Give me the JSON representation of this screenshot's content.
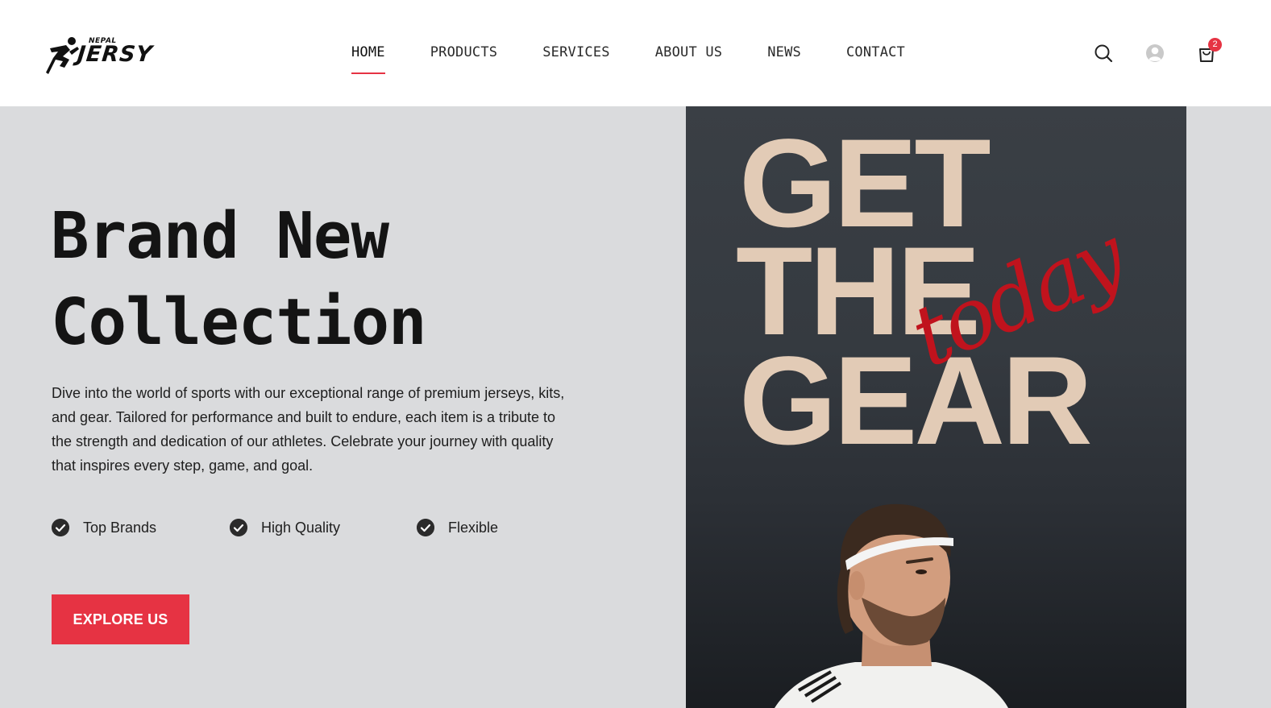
{
  "brand": {
    "small": "NEPAL",
    "main": "JERSY"
  },
  "nav": {
    "items": [
      {
        "label": "HOME",
        "active": true
      },
      {
        "label": "PRODUCTS",
        "active": false
      },
      {
        "label": "SERVICES",
        "active": false
      },
      {
        "label": "ABOUT US",
        "active": false
      },
      {
        "label": "NEWS",
        "active": false
      },
      {
        "label": "CONTACT",
        "active": false
      }
    ]
  },
  "header_icons": {
    "search": "search-icon",
    "account": "user-icon",
    "cart": "shopping-bag-icon",
    "cart_count": "2"
  },
  "hero": {
    "title_line1": "Brand New",
    "title_line2": "Collection",
    "description": "Dive into the world of  sports with our exceptional range of premium jerseys, kits, and gear. Tailored for performance and built to endure, each item is a tribute to the strength and dedication of our athletes. Celebrate your journey with quality that inspires every step, game, and goal.",
    "features": [
      "Top Brands",
      "High Quality",
      "Flexible"
    ],
    "cta": "EXPLORE US"
  },
  "poster": {
    "line1": "GET",
    "line2": "THE",
    "line3": "GEAR",
    "script": "today"
  },
  "colors": {
    "accent": "#e63343",
    "hero_bg": "#dadbdd",
    "poster_text": "#e2cbb6",
    "poster_script": "#c0131d"
  }
}
